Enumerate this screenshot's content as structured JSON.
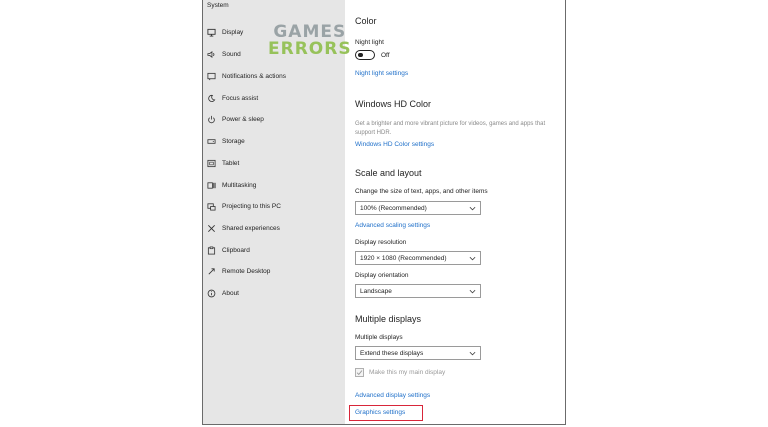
{
  "sidebar": {
    "title": "System",
    "items": [
      {
        "label": "Display",
        "icon": "monitor-icon"
      },
      {
        "label": "Sound",
        "icon": "speaker-icon"
      },
      {
        "label": "Notifications & actions",
        "icon": "notification-icon"
      },
      {
        "label": "Focus assist",
        "icon": "moon-icon"
      },
      {
        "label": "Power & sleep",
        "icon": "power-icon"
      },
      {
        "label": "Storage",
        "icon": "storage-icon"
      },
      {
        "label": "Tablet",
        "icon": "tablet-icon"
      },
      {
        "label": "Multitasking",
        "icon": "multitasking-icon"
      },
      {
        "label": "Projecting to this PC",
        "icon": "projector-icon"
      },
      {
        "label": "Shared experiences",
        "icon": "shared-icon"
      },
      {
        "label": "Clipboard",
        "icon": "clipboard-icon"
      },
      {
        "label": "Remote Desktop",
        "icon": "remote-icon"
      },
      {
        "label": "About",
        "icon": "info-icon"
      }
    ]
  },
  "color": {
    "heading": "Color",
    "night_light_label": "Night light",
    "night_light_state": "Off",
    "night_light_link": "Night light settings"
  },
  "hdr": {
    "heading": "Windows HD Color",
    "description": "Get a brighter and more vibrant picture for videos, games and apps that support HDR.",
    "link": "Windows HD Color settings"
  },
  "scale": {
    "heading": "Scale and layout",
    "size_label": "Change the size of text, apps, and other items",
    "size_value": "100% (Recommended)",
    "advanced_link": "Advanced scaling settings",
    "resolution_label": "Display resolution",
    "resolution_value": "1920 × 1080 (Recommended)",
    "orientation_label": "Display orientation",
    "orientation_value": "Landscape"
  },
  "multiple": {
    "heading": "Multiple displays",
    "label": "Multiple displays",
    "value": "Extend these displays",
    "main_display_label": "Make this my main display",
    "main_display_checked": true,
    "advanced_link": "Advanced display settings",
    "graphics_link": "Graphics settings"
  },
  "watermark": {
    "line1": "GAMES",
    "line2": "ERRORS"
  },
  "colors": {
    "link": "#1e6fc9",
    "highlight": "#d8263a",
    "sidebar": "#e6e6e6"
  }
}
